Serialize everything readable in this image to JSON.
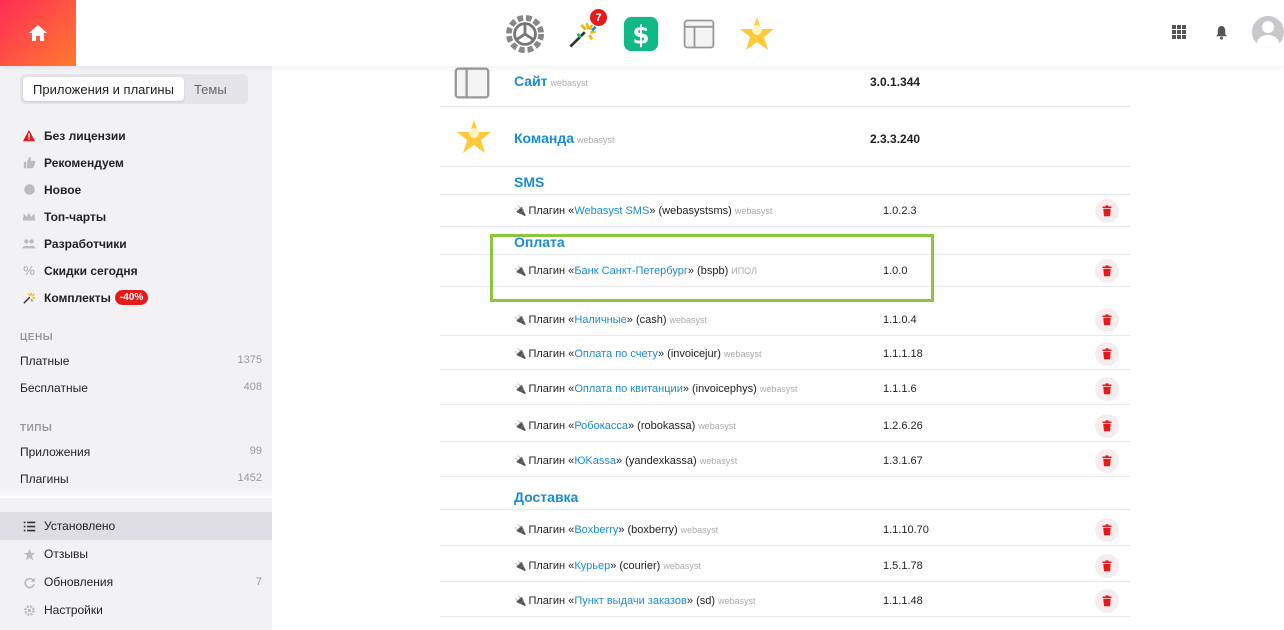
{
  "header": {
    "apps": [
      {
        "name": "installer"
      },
      {
        "name": "shop-script",
        "badge": "7"
      },
      {
        "name": "cashbook"
      },
      {
        "name": "site"
      },
      {
        "name": "team"
      }
    ]
  },
  "sidebar": {
    "tabs": [
      "Приложения и плагины",
      "Темы"
    ],
    "nav": [
      {
        "label": "Без лицензии",
        "icon": "warning-icon"
      },
      {
        "label": "Рекомендуем",
        "icon": "thumbs-up-icon"
      },
      {
        "label": "Новое",
        "icon": "new-icon"
      },
      {
        "label": "Топ-чарты",
        "icon": "crown-icon"
      },
      {
        "label": "Разработчики",
        "icon": "users-icon"
      },
      {
        "label": "Скидки сегодня",
        "icon": "percent-icon"
      },
      {
        "label": "Комплекты",
        "icon": "sparkle-icon",
        "promo": "-40%"
      }
    ],
    "prices_heading": "ЦЕНЫ",
    "prices": [
      {
        "label": "Платные",
        "count": "1375"
      },
      {
        "label": "Бесплатные",
        "count": "408"
      }
    ],
    "types_heading": "ТИПЫ",
    "types": [
      {
        "label": "Приложения",
        "count": "99"
      },
      {
        "label": "Плагины",
        "count": "1452"
      }
    ],
    "bottom": [
      {
        "label": "Установлено",
        "icon": "list-icon",
        "active": true
      },
      {
        "label": "Отзывы",
        "icon": "star-icon"
      },
      {
        "label": "Обновления",
        "icon": "refresh-icon",
        "count": "7"
      },
      {
        "label": "Настройки",
        "icon": "gear-icon"
      }
    ]
  },
  "apps": [
    {
      "name": "Сайт",
      "vendor": "webasyst",
      "version": "3.0.1.344"
    },
    {
      "name": "Команда",
      "vendor": "webasyst",
      "version": "2.3.3.240"
    }
  ],
  "sections": [
    {
      "title": "SMS",
      "plugins": [
        {
          "prefix": "Плагин «",
          "link": "Webasyst SMS",
          "suffix": "» (webasystsms)",
          "vendor": "webasyst",
          "version": "1.0.2.3"
        }
      ]
    },
    {
      "title": "Оплата",
      "plugins": [
        {
          "prefix": "Плагин «",
          "link": "Банк Санкт-Петербург",
          "suffix": "» (bspb)",
          "vendor": "ИПОЛ",
          "version": "1.0.0"
        },
        {
          "prefix": "Плагин «",
          "link": "Наличные",
          "suffix": "» (cash)",
          "vendor": "webasyst",
          "version": "1.1.0.4"
        },
        {
          "prefix": "Плагин «",
          "link": "Оплата по счету",
          "suffix": "» (invoicejur)",
          "vendor": "webasyst",
          "version": "1.1.1.18"
        },
        {
          "prefix": "Плагин «",
          "link": "Оплата по квитанции",
          "suffix": "» (invoicephys)",
          "vendor": "webasyst",
          "version": "1.1.1.6"
        },
        {
          "prefix": "Плагин «",
          "link": "Робокасса",
          "suffix": "» (robokassa)",
          "vendor": "webasyst",
          "version": "1.2.6.26"
        },
        {
          "prefix": "Плагин «",
          "link": "ЮKassa",
          "suffix": "» (yandexkassa)",
          "vendor": "webasyst",
          "version": "1.3.1.67"
        }
      ]
    },
    {
      "title": "Доставка",
      "plugins": [
        {
          "prefix": "Плагин «",
          "link": "Boxberry",
          "suffix": "» (boxberry)",
          "vendor": "webasyst",
          "version": "1.1.10.70"
        },
        {
          "prefix": "Плагин «",
          "link": "Курьер",
          "suffix": "» (courier)",
          "vendor": "webasyst",
          "version": "1.5.1.78"
        },
        {
          "prefix": "Плагин «",
          "link": "Пункт выдачи заказов",
          "suffix": "» (sd)",
          "vendor": "webasyst",
          "version": "1.1.1.48"
        }
      ]
    }
  ],
  "colors": {
    "accent": "#1a8bd6",
    "highlight": "#8cc63f",
    "danger": "#e61a1a"
  }
}
